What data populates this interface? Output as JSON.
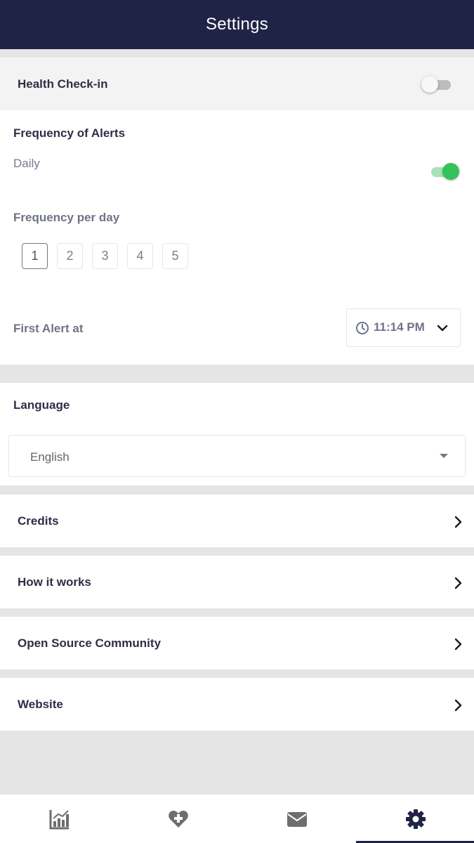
{
  "header": {
    "title": "Settings"
  },
  "health_checkin": {
    "label": "Health Check-in",
    "toggle_on": false
  },
  "alerts": {
    "title": "Frequency of Alerts",
    "frequency_value": "Daily",
    "daily_toggle_on": true,
    "per_day_label": "Frequency per day",
    "per_day_options": [
      "1",
      "2",
      "3",
      "4",
      "5"
    ],
    "per_day_selected": "1",
    "first_alert_label": "First Alert at",
    "first_alert_time": "11:14 PM"
  },
  "language": {
    "title": "Language",
    "selected": "English"
  },
  "links": {
    "credits": "Credits",
    "how_it_works": "How it works",
    "open_source": "Open Source Community",
    "website": "Website"
  },
  "bottom_nav": {
    "items": [
      "chart-icon",
      "heart-plus-icon",
      "envelope-icon",
      "gear-icon"
    ],
    "active": "gear-icon"
  },
  "colors": {
    "header_bg": "#1f2447",
    "toggle_on": "#33c35a",
    "toggle_off": "#bdbdbd",
    "background": "#e5e5e5"
  }
}
